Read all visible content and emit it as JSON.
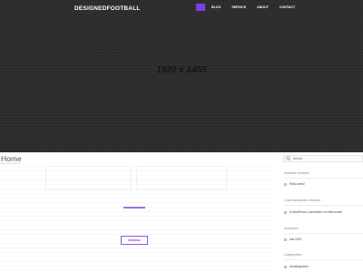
{
  "header": {
    "brand": "DESIGNEDFOOTBALL",
    "nav": [
      {
        "label": "",
        "active": true
      },
      {
        "label": "BLOG",
        "active": false
      },
      {
        "label": "SERVICE",
        "active": false
      },
      {
        "label": "ABOUT",
        "active": false
      },
      {
        "label": "CONTACT",
        "active": false
      }
    ]
  },
  "hero": {
    "placeholder_text": "1920 x 1455"
  },
  "main": {
    "title": "Home",
    "button_label": "Continue"
  },
  "sidebar": {
    "search": {
      "placeholder": "Search ..."
    },
    "recent_posts": {
      "title": "Articles récents",
      "items": [
        "Hello world!"
      ]
    },
    "recent_comments": {
      "title": "Commentaires récents",
      "items": [
        "A WordPress Commenter on Hello world!"
      ]
    },
    "archives": {
      "title": "Archives",
      "items": [
        "mai 2023"
      ]
    },
    "categories": {
      "title": "Catégories",
      "items": [
        "Uncategorized"
      ]
    }
  },
  "colors": {
    "accent": "#7b3fe4",
    "hero_bg": "#2d2d2d"
  }
}
